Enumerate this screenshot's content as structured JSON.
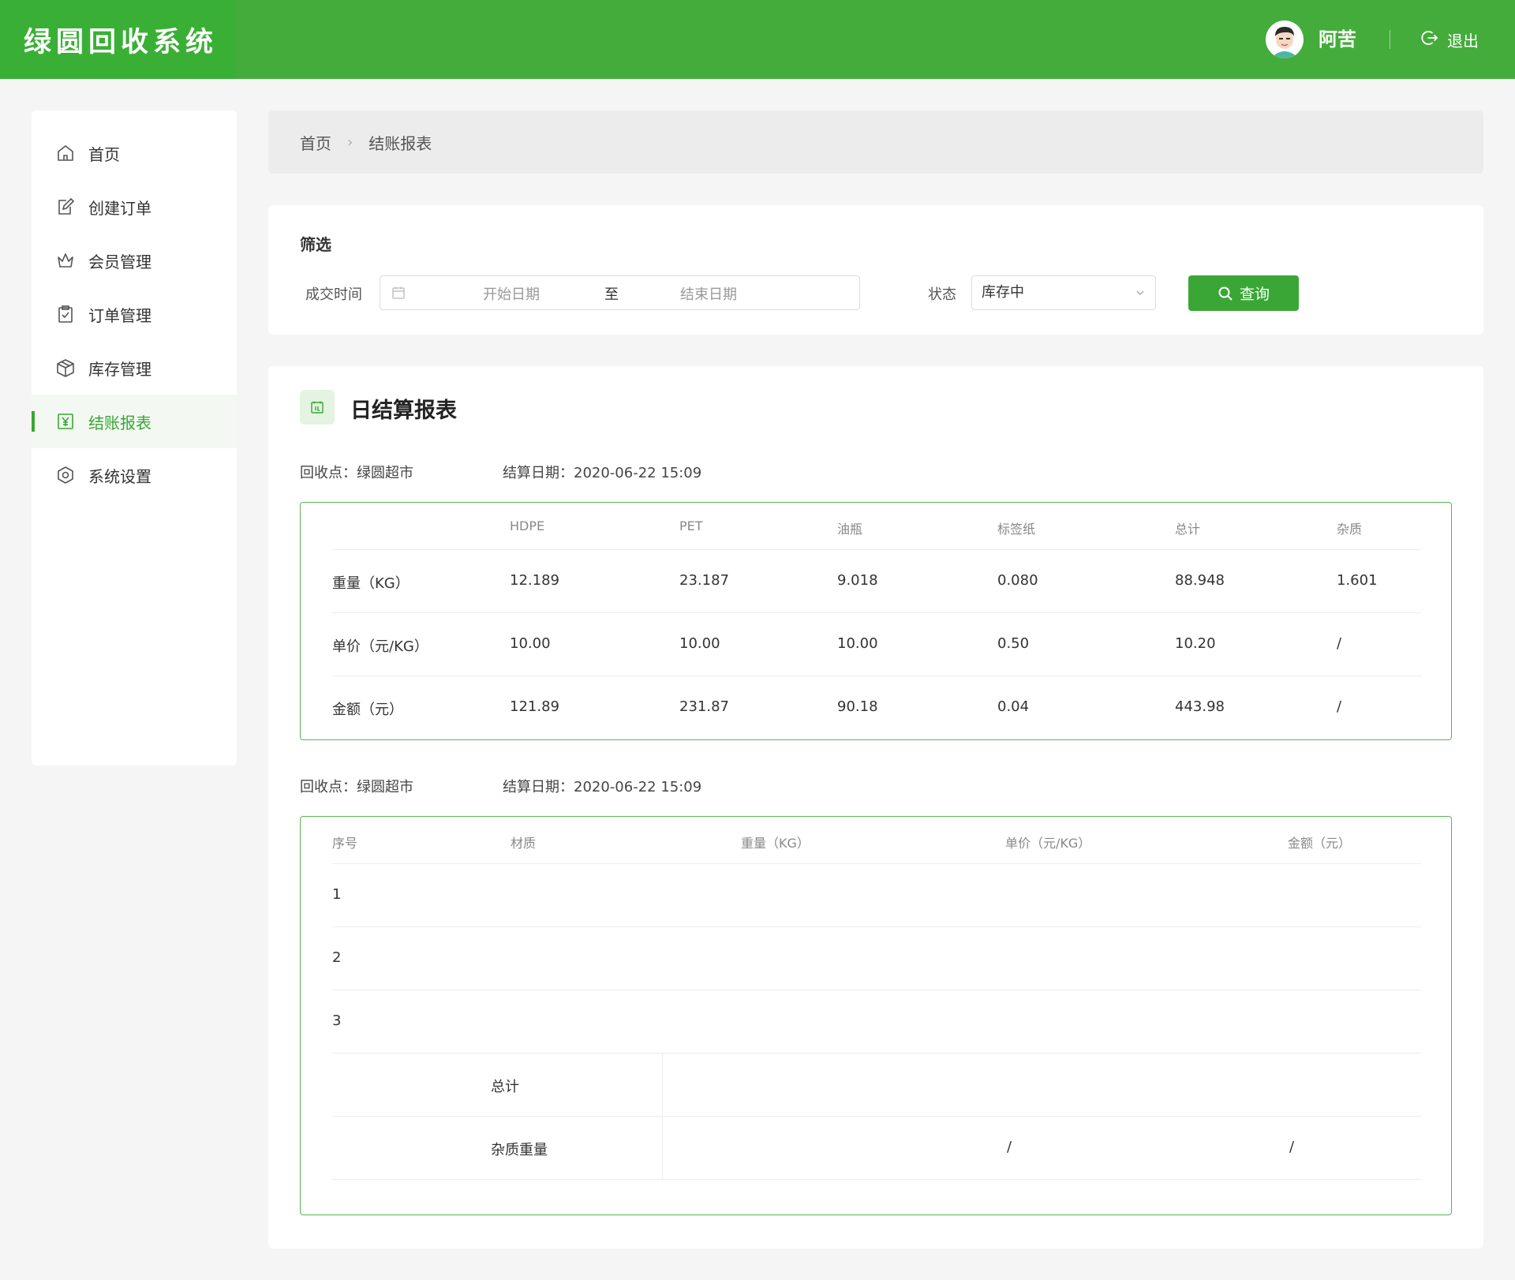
{
  "app": {
    "title": "绿圆回收系统"
  },
  "header": {
    "user_name": "阿苦",
    "logout_label": "退出"
  },
  "sidebar": {
    "items": [
      {
        "label": "首页",
        "icon": "home-icon"
      },
      {
        "label": "创建订单",
        "icon": "edit-icon"
      },
      {
        "label": "会员管理",
        "icon": "crown-icon"
      },
      {
        "label": "订单管理",
        "icon": "clipboard-icon"
      },
      {
        "label": "库存管理",
        "icon": "box-icon"
      },
      {
        "label": "结账报表",
        "icon": "yen-icon",
        "active": true
      },
      {
        "label": "系统设置",
        "icon": "gear-icon"
      }
    ]
  },
  "breadcrumb": {
    "home": "首页",
    "current": "结账报表"
  },
  "filter": {
    "title": "筛选",
    "date_label": "成交时间",
    "start_placeholder": "开始日期",
    "to": "至",
    "end_placeholder": "结束日期",
    "status_label": "状态",
    "status_value": "库存中",
    "query_label": "查询"
  },
  "report": {
    "title": "日结算报表",
    "meta1": {
      "point": "回收点：绿圆超市",
      "date": "结算日期：2020-06-22  15:09"
    },
    "meta2": {
      "point": "回收点：绿圆超市",
      "date": "结算日期：2020-06-22  15:09"
    },
    "table1": {
      "headers": [
        "",
        "HDPE",
        "PET",
        "油瓶",
        "标签纸",
        "总计",
        "杂质"
      ],
      "rows": [
        [
          "重量（KG）",
          "12.189",
          "23.187",
          "9.018",
          "0.080",
          "88.948",
          "1.601"
        ],
        [
          "单价（元/KG）",
          "10.00",
          "10.00",
          "10.00",
          "0.50",
          "10.20",
          "/"
        ],
        [
          "金额（元）",
          "121.89",
          "231.87",
          "90.18",
          "0.04",
          "443.98",
          "/"
        ]
      ]
    },
    "table2": {
      "headers": [
        "序号",
        "材质",
        "重量（KG）",
        "单价（元/KG）",
        "金额（元）"
      ],
      "rows": [
        "1",
        "2",
        "3"
      ],
      "total_label": "总计",
      "impurity_label": "杂质重量",
      "impurity_price": "/",
      "impurity_amount": "/"
    }
  },
  "colors": {
    "brand": "#44ac3b",
    "accent": "#3aa636",
    "border": "#5ab455"
  }
}
